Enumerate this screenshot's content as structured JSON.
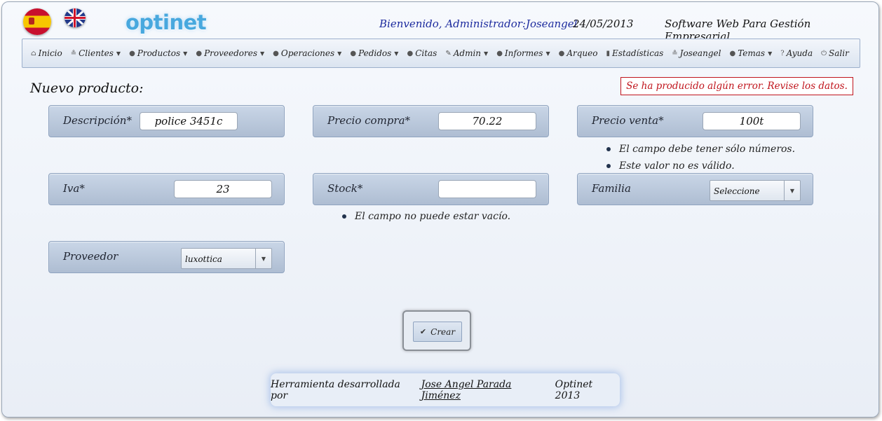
{
  "header": {
    "logo": "optinet",
    "welcome": "Bienvenido, Administrador:Joseangel",
    "date": "24/05/2013",
    "tagline": "Software Web Para Gestión Empresarial."
  },
  "menu": [
    {
      "label": "Inicio",
      "icon": "home-icon",
      "glyph": "⌂",
      "caret": false
    },
    {
      "label": "Clientes",
      "icon": "user-icon",
      "glyph": "≗",
      "caret": true
    },
    {
      "label": "Productos",
      "icon": "bullet-icon",
      "glyph": "●",
      "caret": true
    },
    {
      "label": "Proveedores",
      "icon": "bullet-icon",
      "glyph": "●",
      "caret": true
    },
    {
      "label": "Operaciones",
      "icon": "bullet-icon",
      "glyph": "●",
      "caret": true
    },
    {
      "label": "Pedidos",
      "icon": "bullet-icon",
      "glyph": "●",
      "caret": true
    },
    {
      "label": "Citas",
      "icon": "bullet-icon",
      "glyph": "●",
      "caret": false
    },
    {
      "label": "Admin",
      "icon": "wrench-icon",
      "glyph": "✎",
      "caret": true
    },
    {
      "label": "Informes",
      "icon": "bullet-icon",
      "glyph": "●",
      "caret": true
    },
    {
      "label": "Arqueo",
      "icon": "bullet-icon",
      "glyph": "●",
      "caret": false
    },
    {
      "label": "Estadísticas",
      "icon": "chart-icon",
      "glyph": "▮",
      "caret": false
    },
    {
      "label": "Joseangel",
      "icon": "user-icon",
      "glyph": "≗",
      "caret": false
    },
    {
      "label": "Temas",
      "icon": "bullet-icon",
      "glyph": "●",
      "caret": true
    },
    {
      "label": "Ayuda",
      "icon": "help-icon",
      "glyph": "?",
      "caret": false
    },
    {
      "label": "Salir",
      "icon": "power-icon",
      "glyph": "⏻",
      "caret": false
    }
  ],
  "page": {
    "title": "Nuevo producto:",
    "error_banner": "Se ha producido algún error. Revise los datos."
  },
  "form": {
    "descripcion": {
      "label": "Descripción*",
      "value": "police 3451c"
    },
    "precio_compra": {
      "label": "Precio compra*",
      "value": "70.22"
    },
    "precio_venta": {
      "label": "Precio venta*",
      "value": "100t",
      "errors": [
        "El campo debe tener sólo números.",
        "Este valor no es válido."
      ]
    },
    "iva": {
      "label": "Iva*",
      "value": "23"
    },
    "stock": {
      "label": "Stock*",
      "value": "",
      "errors": [
        "El campo no puede estar vacío."
      ]
    },
    "familia": {
      "label": "Familia",
      "selected": "Seleccione"
    },
    "proveedor": {
      "label": "Proveedor",
      "selected": "luxottica"
    }
  },
  "actions": {
    "create_label": "Crear"
  },
  "footer": {
    "prefix": "Herramienta desarrollada por",
    "author": "Jose Angel Parada Jiménez",
    "suffix": "Optinet 2013"
  }
}
